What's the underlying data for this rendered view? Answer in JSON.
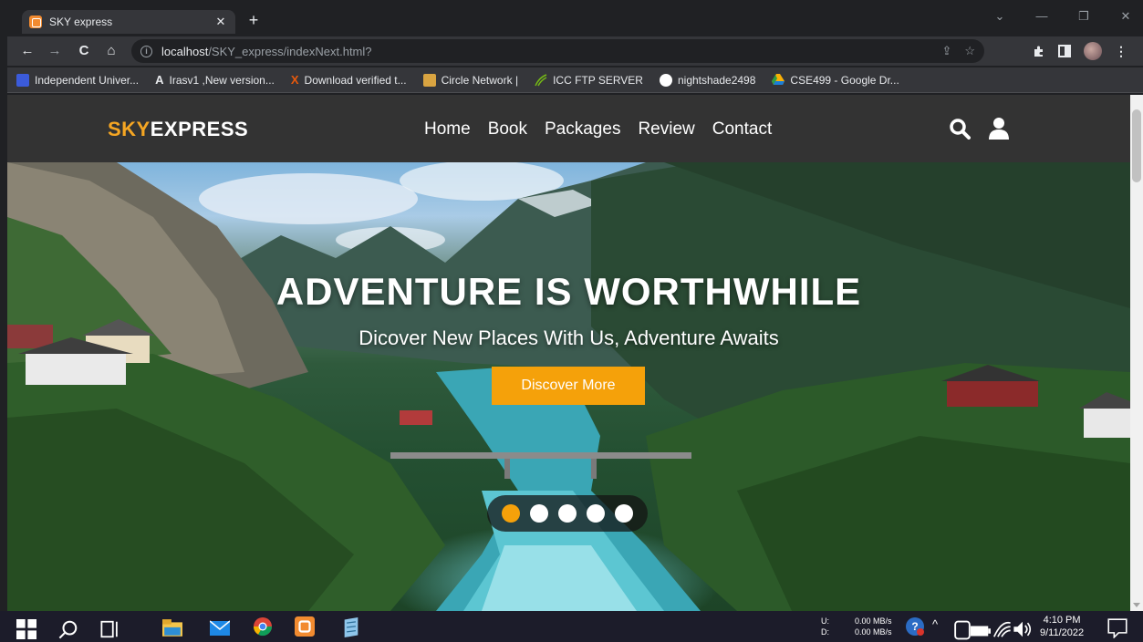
{
  "browser": {
    "tab_title": "SKY express",
    "tab_close": "✕",
    "new_tab": "+",
    "window_controls": {
      "menu": "⌄",
      "minimize": "—",
      "restore": "❐",
      "close": "✕"
    },
    "nav": {
      "back": "←",
      "forward": "→",
      "reload": "C",
      "home": "⌂"
    },
    "url_host": "localhost",
    "url_path": "/SKY_express/indexNext.html?",
    "omni_icons": {
      "share": "⇪",
      "star": "☆"
    },
    "bookmarks": [
      {
        "label": "Independent Univer...",
        "icon_color": "#3b5bdb"
      },
      {
        "label": "Irasv1 ,New version...",
        "icon_color": "#000000"
      },
      {
        "label": "Download verified t...",
        "icon_color": "#e8590c"
      },
      {
        "label": "Circle Network |",
        "icon_color": "#d9a441"
      },
      {
        "label": "ICC FTP SERVER",
        "icon_color": "#74b816"
      },
      {
        "label": "nightshade2498",
        "icon_color": "#ffffff"
      },
      {
        "label": "CSE499 - Google Dr...",
        "icon_color": "#fab005"
      }
    ]
  },
  "site": {
    "logo_accent": "SKY",
    "logo_main": "EXPRESS",
    "nav": [
      "Home",
      "Book",
      "Packages",
      "Review",
      "Contact"
    ],
    "hero": {
      "title": "ADVENTURE IS WORTHWHILE",
      "subtitle": "Dicover New Places With Us, Adventure Awaits",
      "button": "Discover More"
    },
    "slider": {
      "total": 5,
      "active": 0
    },
    "colors": {
      "accent": "#f5a10a",
      "header_bg": "#333333"
    }
  },
  "taskbar": {
    "net_up_label": "U:",
    "net_down_label": "D:",
    "net_up": "0.00 MB/s",
    "net_down": "0.00 MB/s",
    "time": "4:10 PM",
    "date": "9/11/2022"
  }
}
